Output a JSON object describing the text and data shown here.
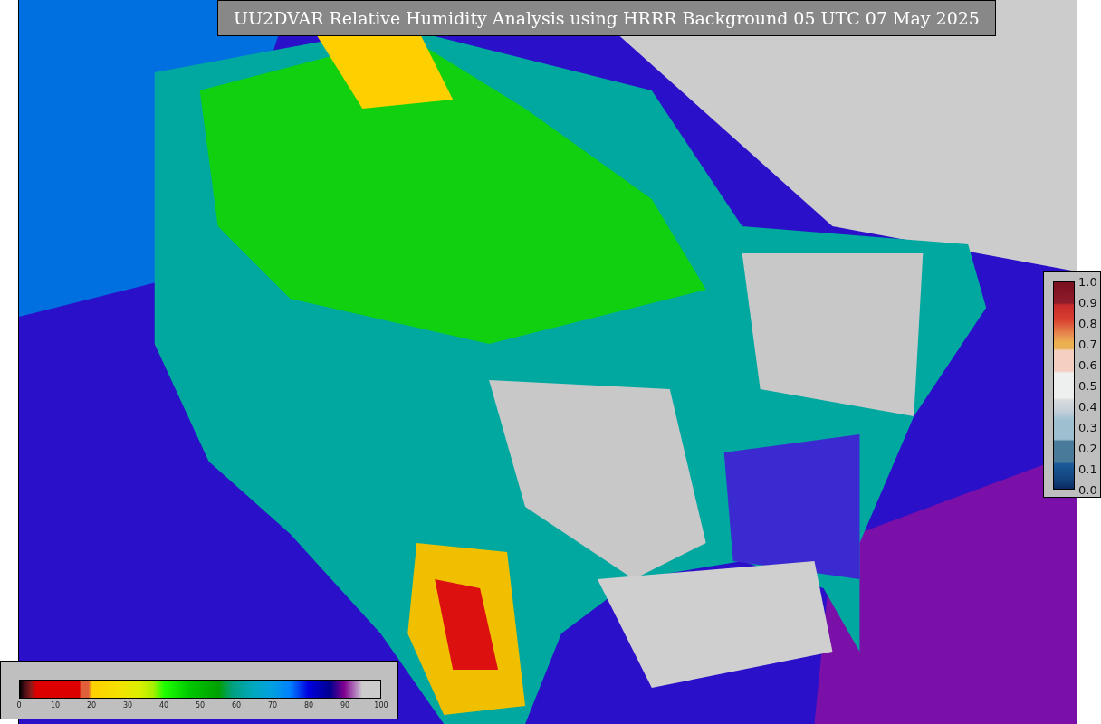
{
  "title": "UU2DVAR Relative Humidity Analysis using HRRR Background 05 UTC 07 May 2025",
  "colorbars": [
    {
      "kind": "horizontal",
      "ticks": [
        "0",
        "10",
        "20",
        "30",
        "40",
        "50",
        "60",
        "70",
        "80",
        "90",
        "100"
      ]
    },
    {
      "kind": "vertical",
      "ticks": [
        "1.0",
        "0.9",
        "0.8",
        "0.7",
        "0.6",
        "0.5",
        "0.4",
        "0.3",
        "0.2",
        "0.1",
        "0.0"
      ]
    }
  ]
}
